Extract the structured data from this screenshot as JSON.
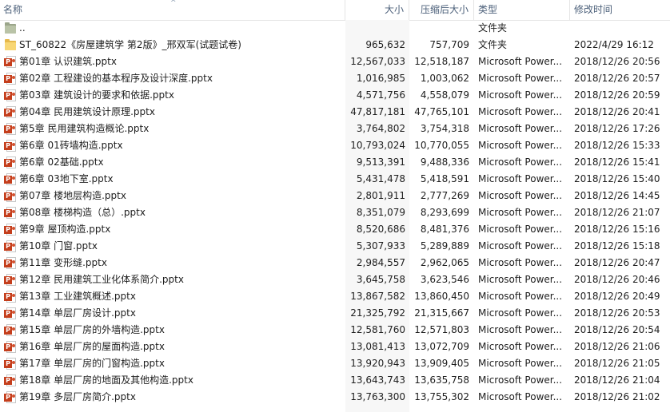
{
  "columns": {
    "name": "名称",
    "size": "大小",
    "compressed": "压缩后大小",
    "type": "类型",
    "modified": "修改时间"
  },
  "sort_indicator": "^",
  "rows": [
    {
      "icon": "parent-folder-icon",
      "name": "..",
      "size": "",
      "compressed": "",
      "type": "文件夹",
      "modified": ""
    },
    {
      "icon": "folder-icon",
      "name": "ST_60822《房屋建筑学 第2版》_邢双军(试题试卷)",
      "size": "965,632",
      "compressed": "757,709",
      "type": "文件夹",
      "modified": "2022/4/29 16:12"
    },
    {
      "icon": "pptx-icon",
      "name": "第01章 认识建筑.pptx",
      "size": "12,567,033",
      "compressed": "12,518,187",
      "type": "Microsoft Power...",
      "modified": "2018/12/26 20:56"
    },
    {
      "icon": "pptx-icon",
      "name": "第02章 工程建设的基本程序及设计深度.pptx",
      "size": "1,016,985",
      "compressed": "1,003,062",
      "type": "Microsoft Power...",
      "modified": "2018/12/26 20:57"
    },
    {
      "icon": "pptx-icon",
      "name": "第03章 建筑设计的要求和依据.pptx",
      "size": "4,571,756",
      "compressed": "4,558,079",
      "type": "Microsoft Power...",
      "modified": "2018/12/26 20:59"
    },
    {
      "icon": "pptx-icon",
      "name": "第04章 民用建筑设计原理.pptx",
      "size": "47,817,181",
      "compressed": "47,765,101",
      "type": "Microsoft Power...",
      "modified": "2018/12/26 20:41"
    },
    {
      "icon": "pptx-icon",
      "name": "第5章 民用建筑构造概论.pptx",
      "size": "3,764,802",
      "compressed": "3,754,318",
      "type": "Microsoft Power...",
      "modified": "2018/12/26 17:26"
    },
    {
      "icon": "pptx-icon",
      "name": "第6章 01砖墙构造.pptx",
      "size": "10,793,024",
      "compressed": "10,770,055",
      "type": "Microsoft Power...",
      "modified": "2018/12/26 15:33"
    },
    {
      "icon": "pptx-icon",
      "name": "第6章 02基础.pptx",
      "size": "9,513,391",
      "compressed": "9,488,336",
      "type": "Microsoft Power...",
      "modified": "2018/12/26 15:41"
    },
    {
      "icon": "pptx-icon",
      "name": "第6章 03地下室.pptx",
      "size": "5,431,478",
      "compressed": "5,418,591",
      "type": "Microsoft Power...",
      "modified": "2018/12/26 15:40"
    },
    {
      "icon": "pptx-icon",
      "name": "第07章 楼地层构造.pptx",
      "size": "2,801,911",
      "compressed": "2,777,269",
      "type": "Microsoft Power...",
      "modified": "2018/12/26 14:45"
    },
    {
      "icon": "pptx-icon",
      "name": "第08章  楼梯构造（总）.pptx",
      "size": "8,351,079",
      "compressed": "8,293,699",
      "type": "Microsoft Power...",
      "modified": "2018/12/26 21:07"
    },
    {
      "icon": "pptx-icon",
      "name": "第9章 屋顶构造.pptx",
      "size": "8,520,686",
      "compressed": "8,481,376",
      "type": "Microsoft Power...",
      "modified": "2018/12/26 15:16"
    },
    {
      "icon": "pptx-icon",
      "name": "第10章 门窗.pptx",
      "size": "5,307,933",
      "compressed": "5,289,889",
      "type": "Microsoft Power...",
      "modified": "2018/12/26 15:18"
    },
    {
      "icon": "pptx-icon",
      "name": "第11章 变形缝.pptx",
      "size": "2,984,557",
      "compressed": "2,962,065",
      "type": "Microsoft Power...",
      "modified": "2018/12/26 20:47"
    },
    {
      "icon": "pptx-icon",
      "name": "第12章 民用建筑工业化体系简介.pptx",
      "size": "3,645,758",
      "compressed": "3,623,546",
      "type": "Microsoft Power...",
      "modified": "2018/12/26 20:46"
    },
    {
      "icon": "pptx-icon",
      "name": "第13章 工业建筑概述.pptx",
      "size": "13,867,582",
      "compressed": "13,860,450",
      "type": "Microsoft Power...",
      "modified": "2018/12/26 20:49"
    },
    {
      "icon": "pptx-icon",
      "name": "第14章 单层厂房设计.pptx",
      "size": "21,325,792",
      "compressed": "21,315,667",
      "type": "Microsoft Power...",
      "modified": "2018/12/26 20:53"
    },
    {
      "icon": "pptx-icon",
      "name": "第15章 单层厂房的外墙构造.pptx",
      "size": "12,581,760",
      "compressed": "12,571,803",
      "type": "Microsoft Power...",
      "modified": "2018/12/26 20:54"
    },
    {
      "icon": "pptx-icon",
      "name": "第16章 单层厂房的屋面构造.pptx",
      "size": "13,081,413",
      "compressed": "13,072,709",
      "type": "Microsoft Power...",
      "modified": "2018/12/26 21:06"
    },
    {
      "icon": "pptx-icon",
      "name": "第17章 单层厂房的门窗构造.pptx",
      "size": "13,920,943",
      "compressed": "13,909,405",
      "type": "Microsoft Power...",
      "modified": "2018/12/26 21:05"
    },
    {
      "icon": "pptx-icon",
      "name": "第18章 单层厂房的地面及其他构造.pptx",
      "size": "13,643,743",
      "compressed": "13,635,758",
      "type": "Microsoft Power...",
      "modified": "2018/12/26 21:04"
    },
    {
      "icon": "pptx-icon",
      "name": "第19章 多层厂房简介.pptx",
      "size": "13,763,300",
      "compressed": "13,755,302",
      "type": "Microsoft Power...",
      "modified": "2018/12/26 21:02"
    }
  ]
}
